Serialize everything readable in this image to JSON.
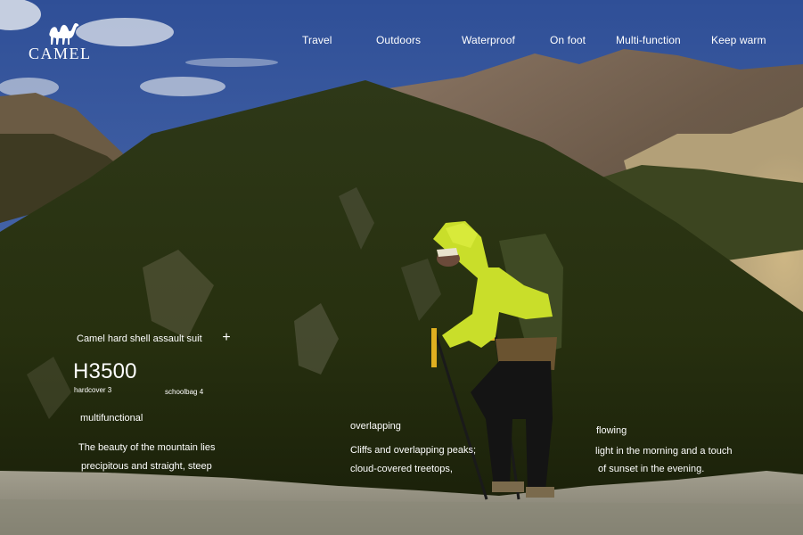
{
  "brand": {
    "name": "CAMEL",
    "logo_icon": "camel-icon"
  },
  "nav": {
    "items": [
      {
        "label": "Travel"
      },
      {
        "label": "Outdoors"
      },
      {
        "label": "Waterproof"
      },
      {
        "label": "On foot"
      },
      {
        "label": "Multi-function"
      },
      {
        "label": "Keep warm"
      }
    ]
  },
  "product": {
    "name": "Camel hard shell assault suit",
    "expand_icon": "plus-icon",
    "expand_symbol": "+",
    "model": "H3500",
    "specs": [
      "hardcover 3",
      "schoolbag 4"
    ]
  },
  "features": [
    {
      "heading": "multifunctional",
      "lines": [
        "The beauty of the mountain lies",
        "precipitous and straight, steep"
      ]
    },
    {
      "heading": "overlapping",
      "lines": [
        "Cliffs and overlapping peaks;",
        "cloud-covered treetops,"
      ]
    },
    {
      "heading": "flowing",
      "lines": [
        "light in the morning and a touch",
        "of sunset in the evening."
      ]
    }
  ],
  "colors": {
    "jacket": "#c9de2a",
    "sky": "#3f62a6",
    "forest": "#2b3315"
  }
}
